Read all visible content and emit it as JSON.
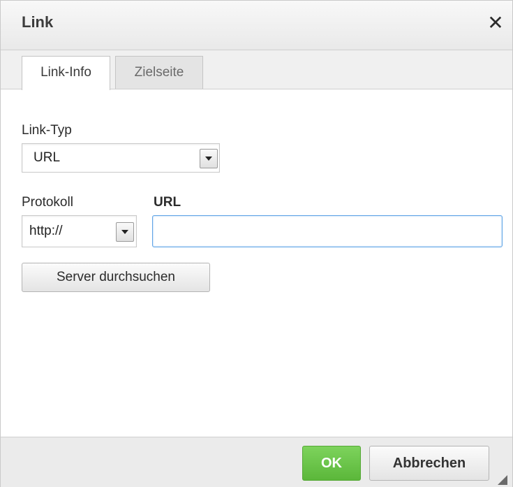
{
  "dialog": {
    "title": "Link",
    "close_icon": "close-x-icon"
  },
  "tabs": [
    {
      "label": "Link-Info",
      "active": true
    },
    {
      "label": "Zielseite",
      "active": false
    }
  ],
  "form": {
    "link_type_label": "Link-Typ",
    "link_type_value": "URL",
    "protocol_label": "Protokoll",
    "protocol_value": "http://",
    "url_label": "URL",
    "url_value": "",
    "server_button": "Server durchsuchen"
  },
  "footer": {
    "ok_label": "OK",
    "cancel_label": "Abbrechen"
  },
  "colors": {
    "ok_green": "#63be3f",
    "focus_blue": "#5fa4e6"
  }
}
